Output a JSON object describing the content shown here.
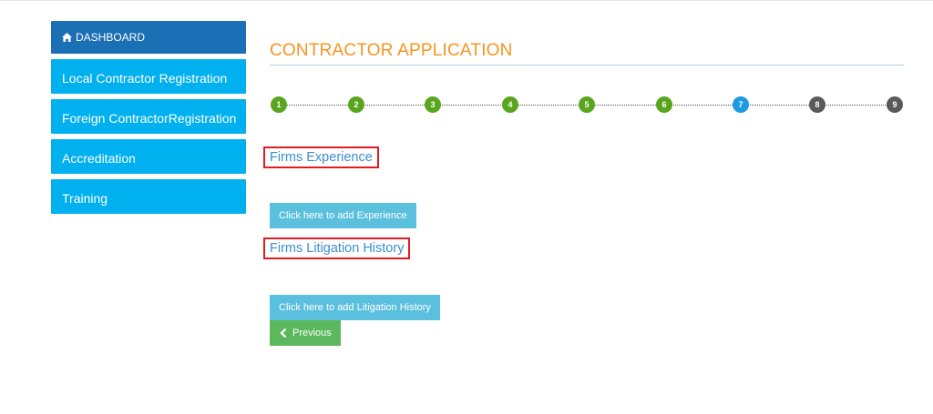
{
  "sidebar": {
    "items": [
      {
        "label": "DASHBOARD",
        "icon": "home-icon"
      },
      {
        "label": "Local Contractor Registration"
      },
      {
        "label": "Foreign ContractorRegistration"
      },
      {
        "label": "Accreditation"
      },
      {
        "label": "Training"
      }
    ]
  },
  "main": {
    "title": "CONTRACTOR APPLICATION",
    "steps": [
      {
        "n": "1",
        "state": "done"
      },
      {
        "n": "2",
        "state": "done"
      },
      {
        "n": "3",
        "state": "done"
      },
      {
        "n": "4",
        "state": "done"
      },
      {
        "n": "5",
        "state": "done"
      },
      {
        "n": "6",
        "state": "done"
      },
      {
        "n": "7",
        "state": "current"
      },
      {
        "n": "8",
        "state": "todo"
      },
      {
        "n": "9",
        "state": "todo"
      }
    ],
    "experience": {
      "title": "Firms Experience",
      "add_button": "Click here to add Experience"
    },
    "litigation": {
      "title": "Firms Litigation History",
      "add_button": "Click here to add Litigation History"
    },
    "previous_button": "Previous"
  },
  "colors": {
    "title_orange": "#f7941d",
    "sidebar_blue": "#00b0ef",
    "dashboard_blue": "#1a6fb5",
    "step_done": "#5aa51e",
    "step_current": "#1c9be0",
    "step_todo": "#5a5a5a",
    "info_button": "#5bc0de",
    "success_button": "#5cb85c",
    "highlight_red": "#e31b23"
  }
}
